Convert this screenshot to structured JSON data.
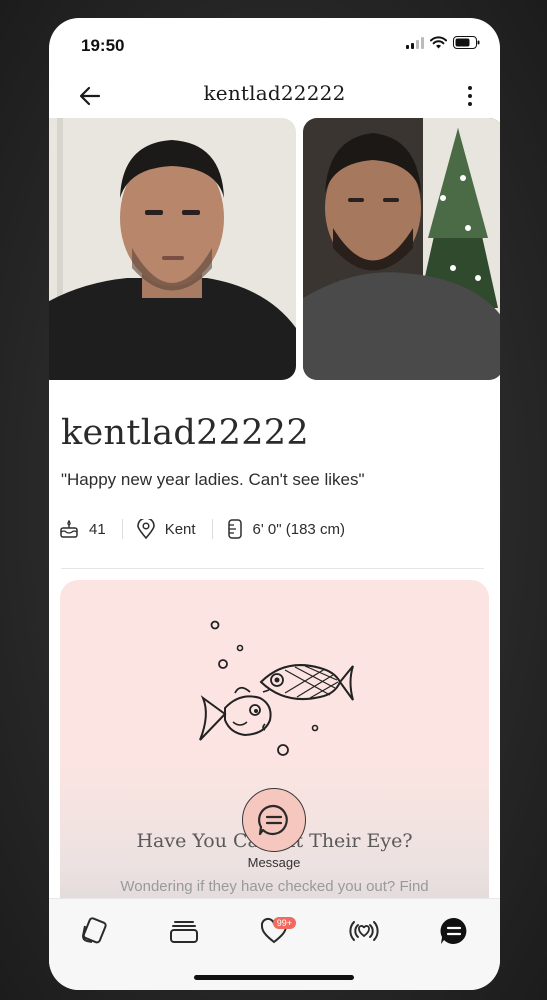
{
  "status_bar": {
    "time": "19:50"
  },
  "header": {
    "title": "kentlad22222"
  },
  "profile": {
    "name": "kentlad22222",
    "bio": "\"Happy new year ladies. Can't see likes\"",
    "facts": [
      {
        "icon": "cake-icon",
        "text": "41"
      },
      {
        "icon": "location-pin-icon",
        "text": "Kent"
      },
      {
        "icon": "ruler-icon",
        "text": "6' 0\" (183 cm)"
      }
    ],
    "photos": [
      {
        "description_icon": "profile-photo-1"
      },
      {
        "description_icon": "profile-photo-2"
      }
    ]
  },
  "prompt_card": {
    "title": "Have You Caught Their Eye?",
    "text": "Wondering if they have checked you out? Find"
  },
  "message_button": {
    "label": "Message"
  },
  "tabbar": {
    "items": [
      {
        "icon": "cards-icon"
      },
      {
        "icon": "stack-icon"
      },
      {
        "icon": "heart-icon",
        "badge": "99+"
      },
      {
        "icon": "broadcast-heart-icon"
      },
      {
        "icon": "chat-icon"
      }
    ]
  },
  "colors": {
    "card_background": "#fbe4e1",
    "message_button": "#f6c7be",
    "badge": "#ef6a5f",
    "active_tab": "#111111"
  }
}
